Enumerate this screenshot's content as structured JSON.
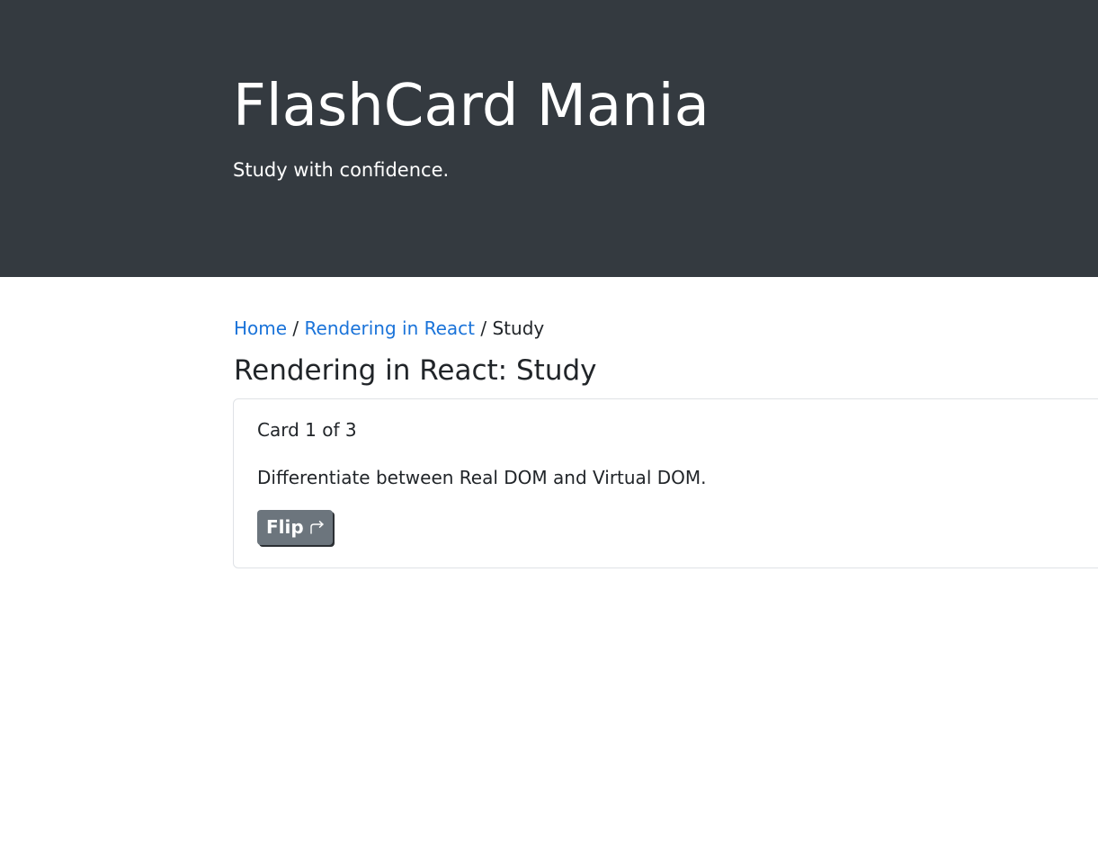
{
  "header": {
    "title": "FlashCard Mania",
    "tagline": "Study with confidence."
  },
  "breadcrumb": {
    "home_label": "Home",
    "deck_label": "Rendering in React",
    "current_label": "Study",
    "separator": "/"
  },
  "page": {
    "heading": "Rendering in React: Study"
  },
  "card": {
    "counter": "Card 1 of 3",
    "front_text": "Differentiate between Real DOM and Virtual DOM.",
    "flip_label": "Flip",
    "flip_icon": "arrow-return-right-icon"
  },
  "colors": {
    "header_bg": "#343a40",
    "link": "#1a73d9",
    "button_secondary": "#6c757d",
    "text": "#212529"
  }
}
